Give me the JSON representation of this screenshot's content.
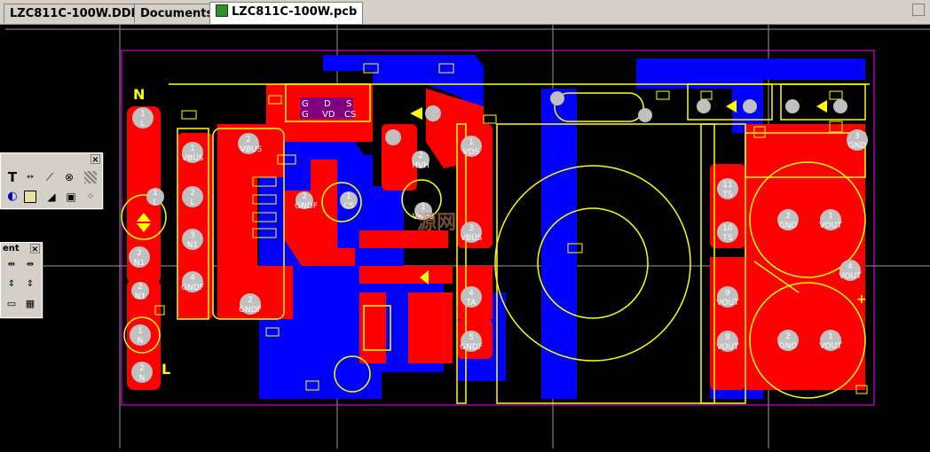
{
  "tabs": [
    {
      "label": "LZC811C-100W.DDB"
    },
    {
      "label": "Documents"
    },
    {
      "label": "LZC811C-100W.pcb"
    }
  ],
  "toolbox_placement": {
    "title": "",
    "close": "×"
  },
  "toolbox_component": {
    "title": "ent",
    "close": "×"
  },
  "board": {
    "labels": {
      "N": "N",
      "L": "L",
      "plus": "+"
    },
    "pads": [
      {
        "num": "1",
        "net": "L"
      },
      {
        "num": "1",
        "net": "VBUS"
      },
      {
        "num": "2",
        "net": "VBUS"
      },
      {
        "num": "2",
        "net": "L"
      },
      {
        "num": "1",
        "net": "L"
      },
      {
        "num": "3",
        "net": "N1"
      },
      {
        "num": "2",
        "net": "N1"
      },
      {
        "num": "4",
        "net": "GNDF"
      },
      {
        "num": "2",
        "net": "N1"
      },
      {
        "num": "1",
        "net": "N"
      },
      {
        "num": "2",
        "net": "N"
      },
      {
        "num": "2",
        "net": "GNDF"
      },
      {
        "num": "2",
        "net": "GNDF"
      },
      {
        "num": "1",
        "net": "CS"
      },
      {
        "num": "2",
        "net": "HVH"
      },
      {
        "num": "1",
        "net": "VDS"
      },
      {
        "num": "1",
        "net": "VBUS"
      },
      {
        "num": "3",
        "net": "VBUS"
      },
      {
        "num": "4",
        "net": "TA"
      },
      {
        "num": "5",
        "net": "GNDF"
      },
      {
        "num": "11",
        "net": "TS"
      },
      {
        "num": "10",
        "net": "TS"
      },
      {
        "num": "9",
        "net": "VOUT"
      },
      {
        "num": "8",
        "net": "VOUT"
      },
      {
        "num": "3",
        "net": "GND"
      },
      {
        "num": "2",
        "net": "GND"
      },
      {
        "num": "1",
        "net": "VOUT"
      },
      {
        "num": "4",
        "net": "VOUT"
      },
      {
        "num": "2",
        "net": "GND"
      },
      {
        "num": "1",
        "net": "VOUT"
      }
    ],
    "small_labels": [
      "G",
      "D",
      "S",
      "G",
      "VD",
      "CS"
    ],
    "watermark": "源网"
  },
  "colors": {
    "top_copper": "#ff0000",
    "bottom_copper": "#0000ff",
    "silkscreen": "#ffff00",
    "board_outline": "#ff00ff",
    "pad": "#c0c0c0",
    "background": "#000000"
  }
}
